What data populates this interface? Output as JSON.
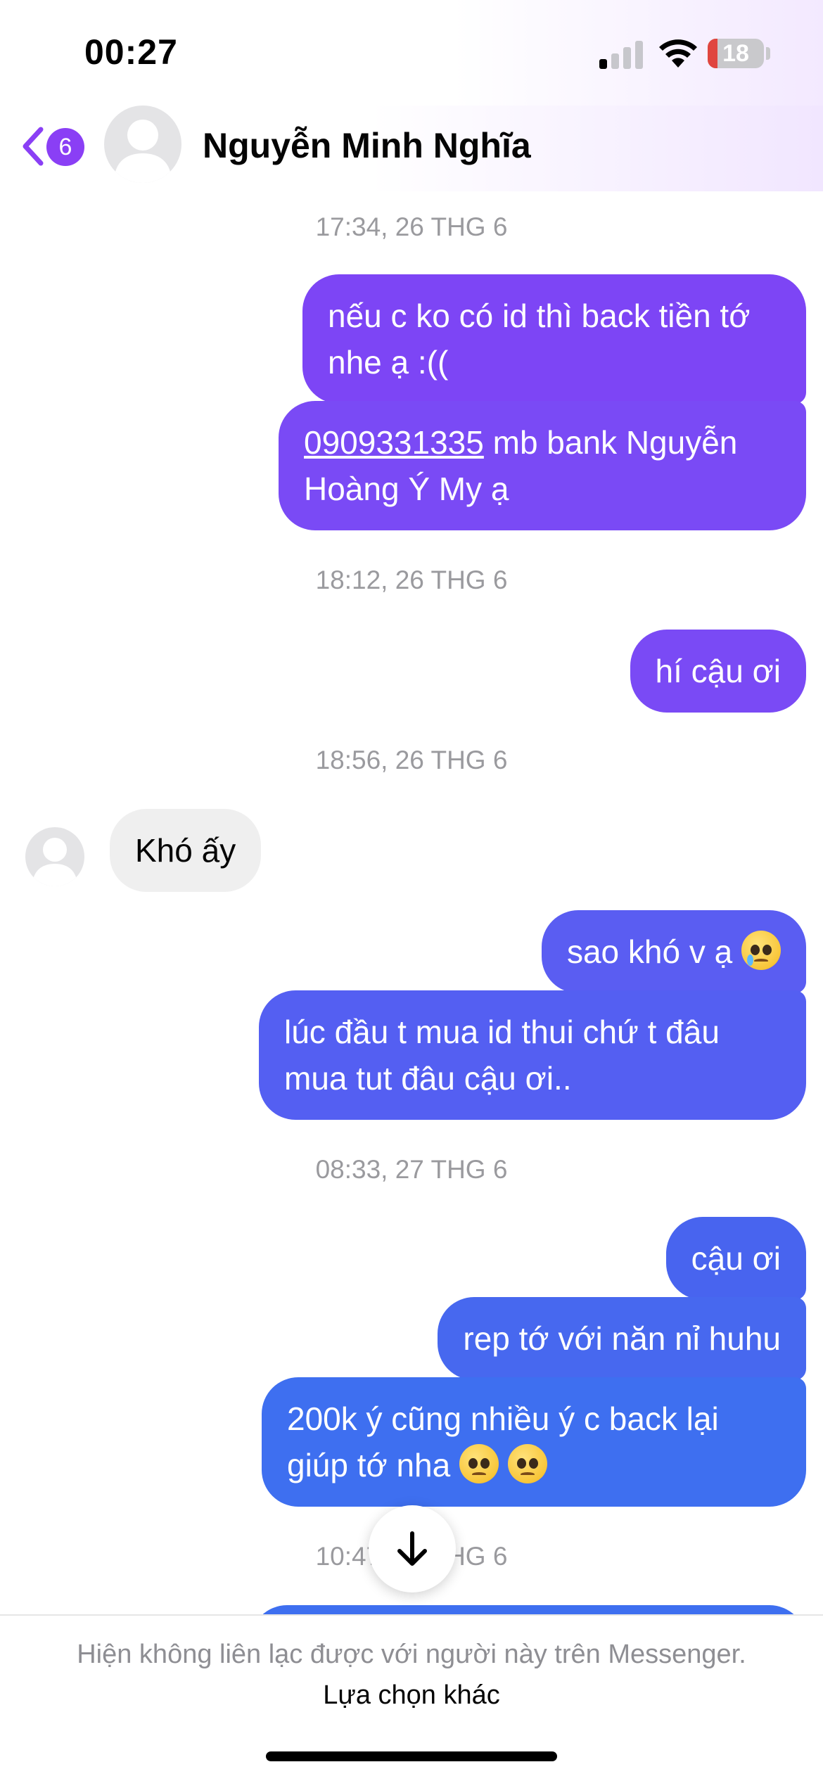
{
  "status_bar": {
    "time": "00:27",
    "battery_level": "18",
    "battery_fill_fraction": 0.18,
    "signal_bars_active": 1,
    "signal_bars_total": 4,
    "icons": [
      "cellular-signal-icon",
      "wifi-icon",
      "battery-icon"
    ]
  },
  "header": {
    "back_badge_count": "6",
    "contact_name": "Nguyễn Minh Nghĩa",
    "icons": [
      "chevron-left-icon",
      "default-avatar-icon"
    ]
  },
  "messages": {
    "timestamps": [
      "17:34, 26 THG 6",
      "18:12, 26 THG 6",
      "18:56, 26 THG 6",
      "08:33, 27 THG 6",
      "10:47, 27 THG 6"
    ],
    "m1": "nếu c ko có id thì back tiền tớ nhe ạ :((",
    "m2_phone": "0909331335",
    "m2_rest": " mb bank Nguyễn Hoàng Ý My ạ",
    "m3": "hí cậu ơi",
    "m4_incoming": "Khó ấy",
    "m5": "sao khó v ạ",
    "m6": "lúc đầu t mua id thui chứ t đâu mua tut đâu cậu ơi..",
    "m7": "cậu ơi",
    "m8": "rep tớ với năn nỉ huhu",
    "m9_line1": "200k ý cũng nhiều ý c back lại",
    "m9_line2": "giúp tớ nha",
    "emojis": [
      "crying-face-emoji",
      "pleading-face-emoji"
    ]
  },
  "scroll_button": {
    "icon": "arrow-down-icon"
  },
  "footer": {
    "notice": "Hiện không liên lạc được với người này trên Messenger.",
    "link": "Lựa chọn khác"
  },
  "colors": {
    "accent_purple": "#8a3ff5",
    "bubble_top": "#7d45f5",
    "bubble_bottom": "#3e6ff0",
    "incoming_bubble": "#efefef",
    "timestamp_gray": "#9a9a9e"
  }
}
